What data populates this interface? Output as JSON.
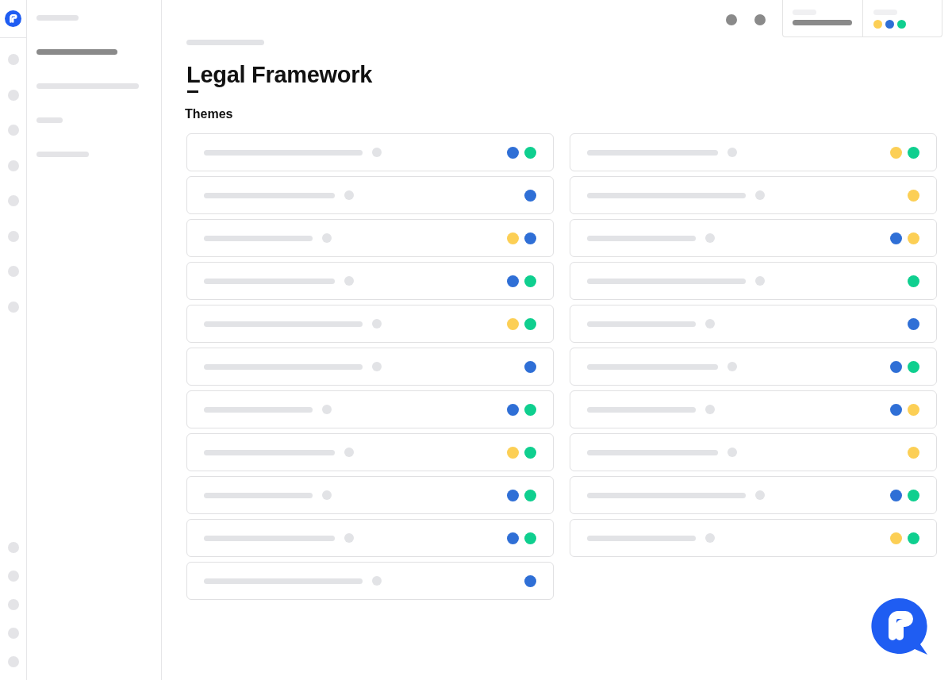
{
  "nav_items": [
    {
      "selected": false
    },
    {
      "selected": true
    },
    {
      "selected": false
    },
    {
      "selected": false
    },
    {
      "selected": false
    }
  ],
  "page": {
    "title": "Legal Framework",
    "section": "Themes"
  },
  "legend": [
    {
      "color": "#fccf55"
    },
    {
      "color": "#2f6fd6"
    },
    {
      "color": "#0fcf8f"
    }
  ],
  "theme_columns": [
    {
      "items": [
        {
          "tags": [
            {
              "color": "#2f6fd6"
            },
            {
              "color": "#0fcf8f"
            }
          ]
        },
        {
          "tags": [
            {
              "color": "#2f6fd6"
            }
          ]
        },
        {
          "tags": [
            {
              "color": "#fccf55"
            },
            {
              "color": "#2f6fd6"
            }
          ]
        },
        {
          "tags": [
            {
              "color": "#2f6fd6"
            },
            {
              "color": "#0fcf8f"
            }
          ]
        },
        {
          "tags": [
            {
              "color": "#fccf55"
            },
            {
              "color": "#0fcf8f"
            }
          ]
        },
        {
          "tags": [
            {
              "color": "#2f6fd6"
            }
          ]
        },
        {
          "tags": [
            {
              "color": "#2f6fd6"
            },
            {
              "color": "#0fcf8f"
            }
          ]
        },
        {
          "tags": [
            {
              "color": "#fccf55"
            },
            {
              "color": "#0fcf8f"
            }
          ]
        },
        {
          "tags": [
            {
              "color": "#2f6fd6"
            },
            {
              "color": "#0fcf8f"
            }
          ]
        },
        {
          "tags": [
            {
              "color": "#2f6fd6"
            },
            {
              "color": "#0fcf8f"
            }
          ]
        },
        {
          "tags": [
            {
              "color": "#2f6fd6"
            }
          ]
        }
      ]
    },
    {
      "items": [
        {
          "tags": [
            {
              "color": "#fccf55"
            },
            {
              "color": "#0fcf8f"
            }
          ]
        },
        {
          "tags": [
            {
              "color": "#fccf55"
            }
          ]
        },
        {
          "tags": [
            {
              "color": "#2f6fd6"
            },
            {
              "color": "#fccf55"
            }
          ]
        },
        {
          "tags": [
            {
              "color": "#0fcf8f"
            }
          ]
        },
        {
          "tags": [
            {
              "color": "#2f6fd6"
            }
          ]
        },
        {
          "tags": [
            {
              "color": "#2f6fd6"
            },
            {
              "color": "#0fcf8f"
            }
          ]
        },
        {
          "tags": [
            {
              "color": "#2f6fd6"
            },
            {
              "color": "#fccf55"
            }
          ]
        },
        {
          "tags": [
            {
              "color": "#fccf55"
            }
          ]
        },
        {
          "tags": [
            {
              "color": "#2f6fd6"
            },
            {
              "color": "#0fcf8f"
            }
          ]
        },
        {
          "tags": [
            {
              "color": "#fccf55"
            },
            {
              "color": "#0fcf8f"
            }
          ]
        }
      ]
    }
  ]
}
